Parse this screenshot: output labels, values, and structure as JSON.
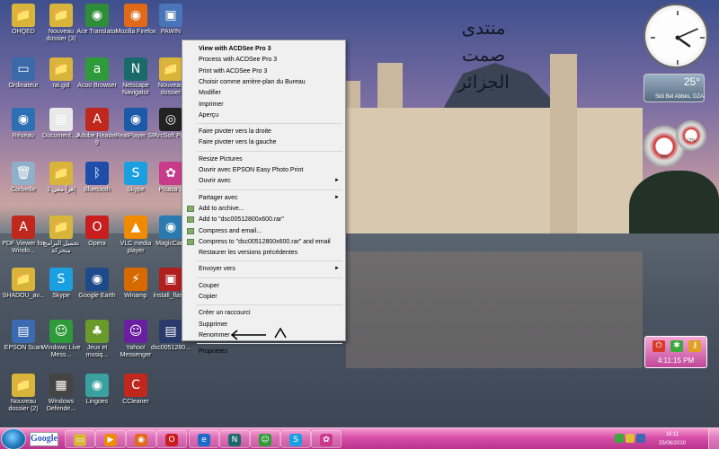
{
  "desktop": {
    "icons": [
      {
        "label": "OHQED",
        "color": "#d8b53a",
        "glyph": "📁",
        "icon": "folder-icon"
      },
      {
        "label": "Nouveau dossier (3)",
        "color": "#d8b53a",
        "glyph": "📁",
        "icon": "folder-icon"
      },
      {
        "label": "Ace Translator",
        "color": "#2f8d3a",
        "glyph": "◉",
        "icon": "globe-icon"
      },
      {
        "label": "Mozilla Firefox",
        "color": "#e06a1a",
        "glyph": "◉",
        "icon": "firefox-icon"
      },
      {
        "label": "PAWIN",
        "color": "#4a74b8",
        "glyph": "▣",
        "icon": "network-icon"
      },
      {
        "label": "Ordinateur",
        "color": "#3b6aa8",
        "glyph": "▭",
        "icon": "computer-icon"
      },
      {
        "label": "rai.gid",
        "color": "#d8b53a",
        "glyph": "📁",
        "icon": "folder-icon"
      },
      {
        "label": "Acoo Browser",
        "color": "#2f9a3a",
        "glyph": "a",
        "icon": "browser-icon"
      },
      {
        "label": "Netscape Navigator",
        "color": "#1b6a6a",
        "glyph": "N",
        "icon": "netscape-icon"
      },
      {
        "label": "Nouveau dossier",
        "color": "#d8b53a",
        "glyph": "📁",
        "icon": "folder-icon"
      },
      {
        "label": "Réseau",
        "color": "#2d6fb3",
        "glyph": "◉",
        "icon": "network-globe-icon"
      },
      {
        "label": "Document...3",
        "color": "#e9e9e9",
        "glyph": "▤",
        "icon": "document-icon"
      },
      {
        "label": "Adobe Reader 9",
        "color": "#c0281e",
        "glyph": "A",
        "icon": "adobe-reader-icon"
      },
      {
        "label": "RealPlayer SP",
        "color": "#1c5aa8",
        "glyph": "◉",
        "icon": "realplayer-icon"
      },
      {
        "label": "ArcSoft Pr...",
        "color": "#222",
        "glyph": "◎",
        "icon": "camera-icon"
      },
      {
        "label": "Corbeille",
        "color": "#8fb0c8",
        "glyph": "🗑",
        "icon": "recycle-bin-icon"
      },
      {
        "label": "إقرأ معي 1",
        "color": "#d8b53a",
        "glyph": "📁",
        "icon": "folder-icon"
      },
      {
        "label": "Bluetooth",
        "color": "#1e4ea8",
        "glyph": "ᛒ",
        "icon": "bluetooth-icon"
      },
      {
        "label": "Skype",
        "color": "#1aa0e0",
        "glyph": "S",
        "icon": "skype-icon"
      },
      {
        "label": "Picasa 3",
        "color": "#c83a8a",
        "glyph": "✿",
        "icon": "picasa-icon"
      },
      {
        "label": "PDF Viewer for Windo...",
        "color": "#c0281e",
        "glyph": "A",
        "icon": "pdf-viewer-icon"
      },
      {
        "label": "تحميل البرامج متحركة",
        "color": "#d8b53a",
        "glyph": "📁",
        "icon": "folder-icon"
      },
      {
        "label": "Opera",
        "color": "#c81e1e",
        "glyph": "O",
        "icon": "opera-icon"
      },
      {
        "label": "VLC media player",
        "color": "#f08a00",
        "glyph": "▲",
        "icon": "vlc-icon"
      },
      {
        "label": "MagicCam",
        "color": "#2a7ab0",
        "glyph": "◉",
        "icon": "webcam-icon"
      },
      {
        "label": "SHADOU_av...",
        "color": "#d8b53a",
        "glyph": "📁",
        "icon": "folder-icon"
      },
      {
        "label": "Skype",
        "color": "#1aa0e0",
        "glyph": "S",
        "icon": "skype-icon"
      },
      {
        "label": "Google Earth",
        "color": "#1f4a8a",
        "glyph": "◉",
        "icon": "google-earth-icon"
      },
      {
        "label": "Winamp",
        "color": "#d66a00",
        "glyph": "⚡",
        "icon": "winamp-icon"
      },
      {
        "label": "install_flas...",
        "color": "#b01e1e",
        "glyph": "▣",
        "icon": "installer-icon"
      },
      {
        "label": "EPSON Scan",
        "color": "#3a6ab0",
        "glyph": "▤",
        "icon": "scanner-icon"
      },
      {
        "label": "Windows Live Mess...",
        "color": "#2f9a3a",
        "glyph": "☺",
        "icon": "messenger-icon"
      },
      {
        "label": "Jeux et musiq...",
        "color": "#6a9a2a",
        "glyph": "♣",
        "icon": "games-icon"
      },
      {
        "label": "Yahoo! Messenger",
        "color": "#6a1ea0",
        "glyph": "☺",
        "icon": "yahoo-messenger-icon"
      },
      {
        "label": "dsc0051280...",
        "color": "#2a3a6a",
        "glyph": "▤",
        "icon": "image-file-icon"
      },
      {
        "label": "Nouveau dossier (2)",
        "color": "#d8b53a",
        "glyph": "📁",
        "icon": "folder-icon"
      },
      {
        "label": "Windows Defende...",
        "color": "#444",
        "glyph": "▦",
        "icon": "defender-icon"
      },
      {
        "label": "Lingoes",
        "color": "#3aa0a0",
        "glyph": "◉",
        "icon": "lingoes-icon"
      },
      {
        "label": "CCleaner",
        "color": "#c0281e",
        "glyph": "C",
        "icon": "ccleaner-icon"
      }
    ],
    "arabic_lines": [
      "منتدى",
      "صمت",
      "الجزائر"
    ]
  },
  "context_menu": {
    "items": [
      {
        "label": "View with ACDSee Pro 3",
        "bold": true,
        "submenu": false,
        "icon": false
      },
      {
        "label": "Process with ACDSee Pro 3",
        "bold": false,
        "submenu": false,
        "icon": false
      },
      {
        "label": "Print with ACDSee Pro 3",
        "bold": false,
        "submenu": false,
        "icon": false
      },
      {
        "label": "Choisir comme arrière-plan du Bureau",
        "bold": false,
        "submenu": false,
        "icon": false
      },
      {
        "label": "Modifier",
        "bold": false,
        "submenu": false,
        "icon": false
      },
      {
        "label": "Imprimer",
        "bold": false,
        "submenu": false,
        "icon": false
      },
      {
        "label": "Aperçu",
        "bold": false,
        "submenu": false,
        "icon": false
      },
      {
        "sep": true
      },
      {
        "label": "Faire pivoter vers la droite",
        "bold": false,
        "submenu": false,
        "icon": false
      },
      {
        "label": "Faire pivoter vers la gauche",
        "bold": false,
        "submenu": false,
        "icon": false
      },
      {
        "sep": true
      },
      {
        "label": "Resize Pictures",
        "bold": false,
        "submenu": false,
        "icon": false
      },
      {
        "label": "Ouvrir avec EPSON Easy Photo Print",
        "bold": false,
        "submenu": false,
        "icon": false
      },
      {
        "label": "Ouvrir avec",
        "bold": false,
        "submenu": true,
        "icon": false
      },
      {
        "sep": true
      },
      {
        "label": "Partager avec",
        "bold": false,
        "submenu": true,
        "icon": false
      },
      {
        "label": "Add to archive...",
        "bold": false,
        "submenu": false,
        "icon": true
      },
      {
        "label": "Add to \"dsc00512800x600.rar\"",
        "bold": false,
        "submenu": false,
        "icon": true
      },
      {
        "label": "Compress and email...",
        "bold": false,
        "submenu": false,
        "icon": true
      },
      {
        "label": "Compress to \"dsc00512800x600.rar\" and email",
        "bold": false,
        "submenu": false,
        "icon": true
      },
      {
        "label": "Restaurer les versions précédentes",
        "bold": false,
        "submenu": false,
        "icon": false
      },
      {
        "sep": true
      },
      {
        "label": "Envoyer vers",
        "bold": false,
        "submenu": true,
        "icon": false
      },
      {
        "sep": true
      },
      {
        "label": "Couper",
        "bold": false,
        "submenu": false,
        "icon": false
      },
      {
        "label": "Copier",
        "bold": false,
        "submenu": false,
        "icon": false
      },
      {
        "sep": true
      },
      {
        "label": "Créer un raccourci",
        "bold": false,
        "submenu": false,
        "icon": false
      },
      {
        "label": "Supprimer",
        "bold": false,
        "submenu": false,
        "icon": false
      },
      {
        "label": "Renommer",
        "bold": false,
        "submenu": false,
        "icon": false
      },
      {
        "sep": true
      },
      {
        "label": "Propriétés",
        "bold": false,
        "submenu": false,
        "icon": false
      }
    ]
  },
  "gadgets": {
    "weather_temp": "25°",
    "weather_city": "Sidi Bel Abbès, DZA",
    "clock_hour": 4,
    "clock_minute": 11,
    "gauge1_label": "5%",
    "gauge2_label": "12%",
    "sys_time": "4:11:15 PM"
  },
  "taskbar": {
    "google_label": "Google",
    "pinned": [
      {
        "name": "explorer",
        "color": "#d8b53a",
        "glyph": "▭",
        "icon": "explorer-icon"
      },
      {
        "name": "media-player",
        "color": "#f08a00",
        "glyph": "▶",
        "icon": "media-player-icon"
      },
      {
        "name": "firefox",
        "color": "#e06a1a",
        "glyph": "◉",
        "icon": "firefox-icon"
      },
      {
        "name": "opera",
        "color": "#c81e1e",
        "glyph": "O",
        "icon": "opera-icon"
      },
      {
        "name": "internet-explorer",
        "color": "#1e6ac8",
        "glyph": "e",
        "icon": "internet-explorer-icon"
      },
      {
        "name": "netscape",
        "color": "#1b6a6a",
        "glyph": "N",
        "icon": "netscape-icon"
      },
      {
        "name": "messenger",
        "color": "#2f9a3a",
        "glyph": "☺",
        "icon": "messenger-icon"
      },
      {
        "name": "skype",
        "color": "#1aa0e0",
        "glyph": "S",
        "icon": "skype-icon"
      },
      {
        "name": "picasa",
        "color": "#c83a8a",
        "glyph": "✿",
        "icon": "picasa-icon"
      }
    ],
    "time": "16:11",
    "date": "25/06/2010"
  }
}
